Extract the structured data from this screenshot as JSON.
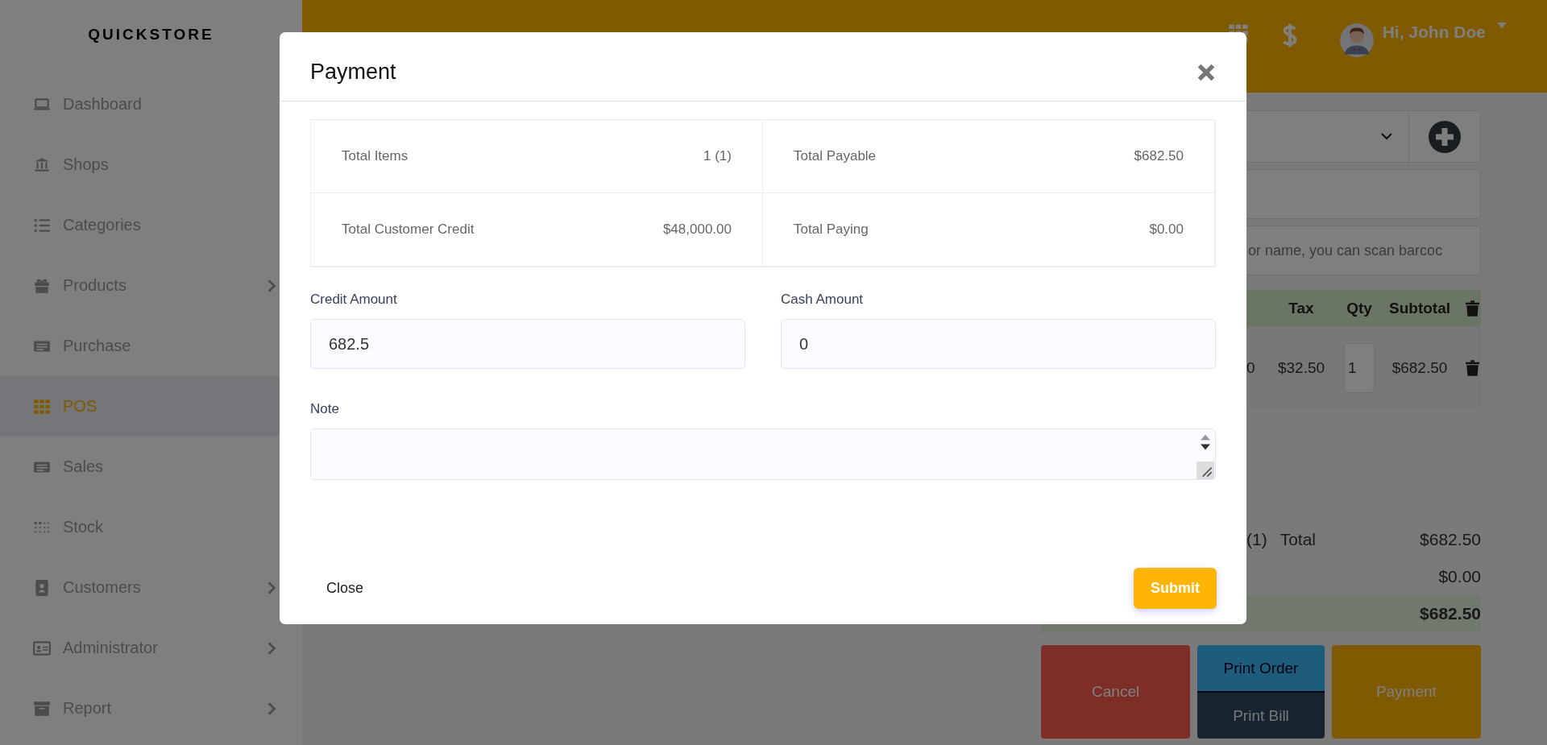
{
  "brand": "QUICKSTORE",
  "sidebar": {
    "items": [
      {
        "label": "Dashboard",
        "kind": "laptop",
        "selected": false,
        "has_submenu": false
      },
      {
        "label": "Shops",
        "kind": "bank",
        "selected": false,
        "has_submenu": false
      },
      {
        "label": "Categories",
        "kind": "list",
        "selected": false,
        "has_submenu": false
      },
      {
        "label": "Products",
        "kind": "gift",
        "selected": false,
        "has_submenu": true
      },
      {
        "label": "Purchase",
        "kind": "receipt",
        "selected": false,
        "has_submenu": false
      },
      {
        "label": "POS",
        "kind": "grid",
        "selected": true,
        "has_submenu": false
      },
      {
        "label": "Sales",
        "kind": "receipt",
        "selected": false,
        "has_submenu": false
      },
      {
        "label": "Stock",
        "kind": "dots",
        "selected": false,
        "has_submenu": false
      },
      {
        "label": "Customers",
        "kind": "contacts",
        "selected": false,
        "has_submenu": true
      },
      {
        "label": "Administrator",
        "kind": "idcard",
        "selected": false,
        "has_submenu": true
      },
      {
        "label": "Report",
        "kind": "archive",
        "selected": false,
        "has_submenu": true
      }
    ]
  },
  "header": {
    "user": "Hi, John Doe"
  },
  "pos": {
    "search_placeholder": "or name, you can scan barcoc",
    "table": {
      "columns": [
        "Tax",
        "Qty",
        "Subtotal"
      ],
      "rows": [
        {
          "price": "0",
          "tax": "$32.50",
          "qty": "1",
          "subtotal": "$682.50"
        }
      ]
    },
    "totals": [
      {
        "items": "(1)",
        "label": "Total",
        "value": "$682.50",
        "highlight": false
      },
      {
        "value": "$0.00",
        "highlight": false
      },
      {
        "value": "$682.50",
        "highlight": true
      }
    ],
    "buttons": [
      {
        "label": "Cancel",
        "kind": "cancel"
      },
      {
        "label": "Print Order",
        "kind": "order"
      },
      {
        "label": "Print Bill",
        "kind": "bill"
      },
      {
        "label": "Payment",
        "kind": "payment"
      }
    ]
  },
  "modal": {
    "title": "Payment",
    "summary": [
      {
        "label": "Total Items",
        "value": "1 (1)"
      },
      {
        "label": "Total Payable",
        "value": "$682.50"
      },
      {
        "label": "Total Customer Credit",
        "value": "$48,000.00"
      },
      {
        "label": "Total Paying",
        "value": "$0.00"
      }
    ],
    "fields": [
      {
        "label": "Credit Amount",
        "value": "682.5"
      },
      {
        "label": "Cash Amount",
        "value": "0"
      }
    ],
    "note": {
      "label": "Note"
    },
    "close": "Close",
    "submit": "Submit"
  }
}
